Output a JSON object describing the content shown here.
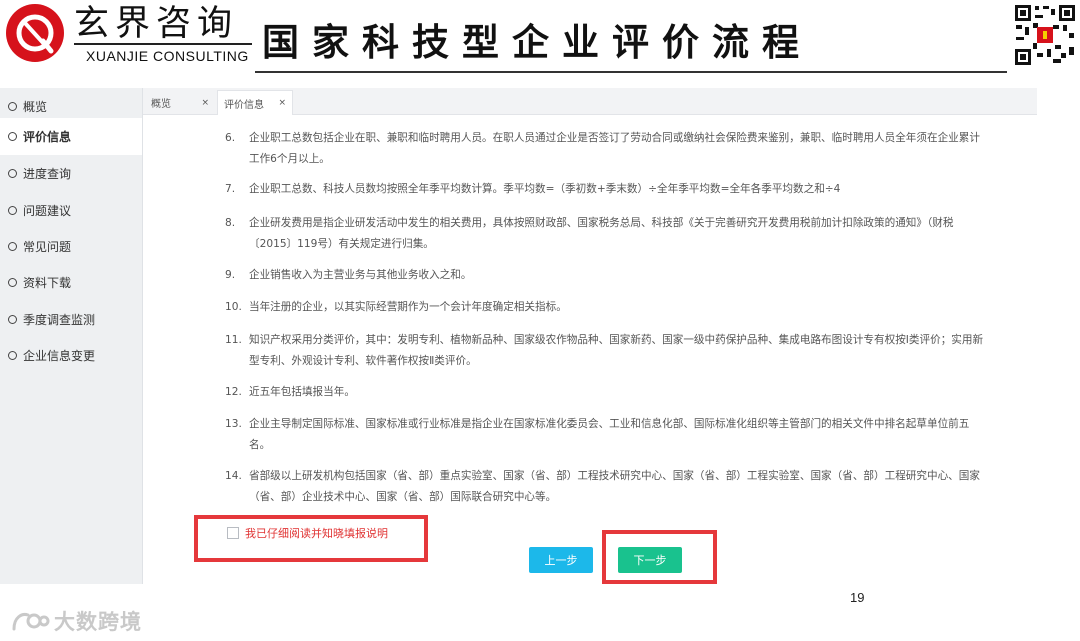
{
  "header": {
    "logo_cn": "玄界咨询",
    "logo_en": "XUANJIE CONSULTING",
    "slide_title": "国家科技型企业评价流程"
  },
  "sidebar": {
    "items": [
      {
        "label": "概览",
        "active": false
      },
      {
        "label": "评价信息",
        "active": true
      },
      {
        "label": "进度查询",
        "active": false
      },
      {
        "label": "问题建议",
        "active": false
      },
      {
        "label": "常见问题",
        "active": false
      },
      {
        "label": "资料下载",
        "active": false
      },
      {
        "label": "季度调查监测",
        "active": false
      },
      {
        "label": "企业信息变更",
        "active": false
      }
    ]
  },
  "tabs": [
    {
      "label": "概览",
      "close": "×"
    },
    {
      "label": "评价信息",
      "close": "×"
    }
  ],
  "notes": [
    {
      "num": "6.",
      "text": "企业职工总数包括企业在职、兼职和临时聘用人员。在职人员通过企业是否签订了劳动合同或缴纳社会保险费来鉴别，兼职、临时聘用人员全年须在企业累计工作6个月以上。"
    },
    {
      "num": "7.",
      "text": "企业职工总数、科技人员数均按照全年季平均数计算。季平均数=（季初数+季末数）÷全年季平均数=全年各季平均数之和÷4"
    },
    {
      "num": "8.",
      "text": "企业研发费用是指企业研发活动中发生的相关费用，具体按照财政部、国家税务总局、科技部《关于完善研究开发费用税前加计扣除政策的通知》（财税〔2015〕119号）有关规定进行归集。"
    },
    {
      "num": "9.",
      "text": "企业销售收入为主营业务与其他业务收入之和。"
    },
    {
      "num": "10.",
      "text": "当年注册的企业，以其实际经营期作为一个会计年度确定相关指标。"
    },
    {
      "num": "11.",
      "text": "知识产权采用分类评价，其中：发明专利、植物新品种、国家级农作物品种、国家新药、国家一级中药保护品种、集成电路布图设计专有权按Ⅰ类评价；实用新型专利、外观设计专利、软件著作权按Ⅱ类评价。"
    },
    {
      "num": "12.",
      "text": "近五年包括填报当年。"
    },
    {
      "num": "13.",
      "text": "企业主导制定国际标准、国家标准或行业标准是指企业在国家标准化委员会、工业和信息化部、国际标准化组织等主管部门的相关文件中排名起草单位前五名。"
    },
    {
      "num": "14.",
      "text": "省部级以上研发机构包括国家（省、部）重点实验室、国家（省、部）工程技术研究中心、国家（省、部）工程实验室、国家（省、部）工程研究中心、国家（省、部）企业技术中心、国家（省、部）国际联合研究中心等。"
    }
  ],
  "agree": {
    "label": "我已仔细阅读并知晓填报说明",
    "checked": false
  },
  "buttons": {
    "prev": "上一步",
    "next": "下一步"
  },
  "page_number": "19",
  "watermark": "大数跨境",
  "colors": {
    "brand_red": "#d6121b",
    "prev_button": "#1cb8ea",
    "next_button": "#19c28e",
    "highlight_box": "#e5383b"
  }
}
